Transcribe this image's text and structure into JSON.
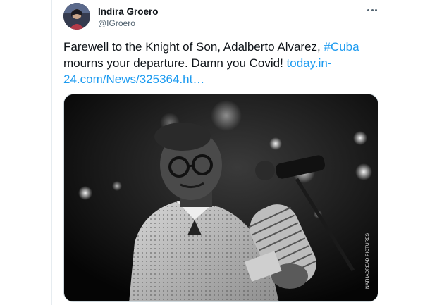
{
  "tweet": {
    "author_name": "Indira Groero",
    "author_handle": "@IGroero",
    "text_before": "Farewell to the Knight of Son, Adalberto Alvarez, ",
    "hashtag": "#Cuba",
    "text_after": " mourns your departure. Damn you Covid! ",
    "link": "today.in-24.com/News/325364.ht…"
  },
  "media": {
    "credit": "NATHADREAD PICTURES"
  },
  "icons": {
    "more": "more-horizontal-icon",
    "avatar": "profile-photo"
  },
  "colors": {
    "link": "#1d9bf0",
    "text": "#0f1419",
    "secondary": "#536471"
  }
}
